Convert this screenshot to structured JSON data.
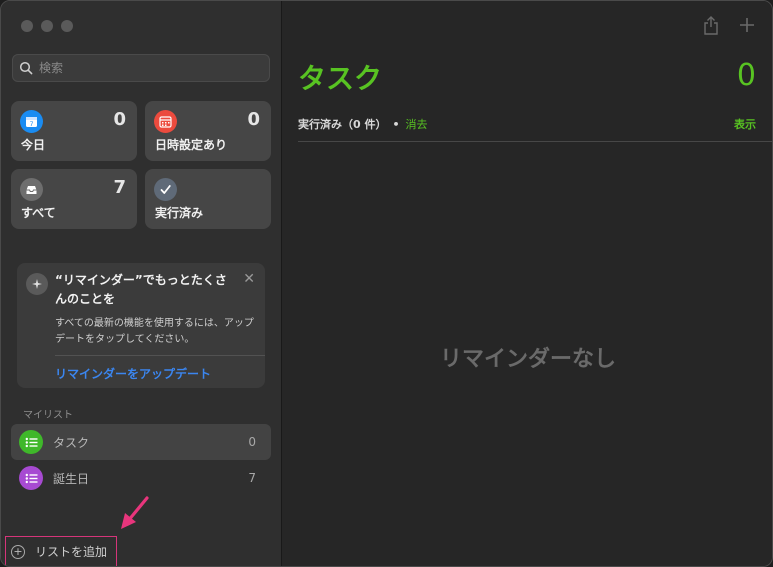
{
  "sidebar": {
    "search": {
      "placeholder": "検索",
      "value": ""
    },
    "smart_lists": [
      {
        "id": "today",
        "label": "今日",
        "count": "0",
        "icon": "calendar-today-icon",
        "color": "#1a8cf2"
      },
      {
        "id": "scheduled",
        "label": "日時設定あり",
        "count": "0",
        "icon": "calendar-grid-icon",
        "color": "#ec4b3e"
      },
      {
        "id": "all",
        "label": "すべて",
        "count": "7",
        "icon": "tray-icon",
        "color": "#6e6e6e"
      },
      {
        "id": "completed",
        "label": "実行済み",
        "count": "",
        "icon": "checkmark-icon",
        "color": "#5f6a78"
      }
    ],
    "promo": {
      "title": "“リマインダー”でもっとたくさんのことを",
      "body": "すべての最新の機能を使用するには、アップデートをタップしてください。",
      "link": "リマインダーをアップデート"
    },
    "my_lists_title": "マイリスト",
    "lists": [
      {
        "name": "タスク",
        "count": "0",
        "color": "#3fb82a",
        "selected": true
      },
      {
        "name": "誕生日",
        "count": "7",
        "color": "#a74ad2",
        "selected": false
      }
    ],
    "add_list_label": "リストを追加"
  },
  "main": {
    "title": "タスク",
    "count": "0",
    "completed_label": "実行済み（0 件）",
    "separator": "•",
    "clear_label": "消去",
    "show_label": "表示",
    "empty_message": "リマインダーなし",
    "accent_color": "#58c322"
  }
}
